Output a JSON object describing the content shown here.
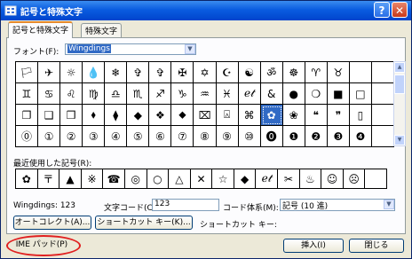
{
  "window": {
    "title": "記号と特殊文字",
    "help_glyph": "?",
    "close_glyph": "✕",
    "title_bar_color": "#0a5ce0"
  },
  "tabs": [
    {
      "label": "記号と特殊文字",
      "active": true
    },
    {
      "label": "特殊文字",
      "active": false
    }
  ],
  "font": {
    "label": "フォント(F):",
    "value": "Wingdings",
    "dropdown_glyph": "▼"
  },
  "symbol_grid": {
    "rows": [
      [
        "🏳",
        "✈",
        "☼",
        "💧",
        "❄",
        "✞",
        "✞",
        "✠",
        "✡",
        "☪",
        "☯",
        "ॐ",
        "☸",
        "♈",
        "♉"
      ],
      [
        "♊",
        "♋",
        "♌",
        "♍",
        "♎",
        "♏",
        "♐",
        "♑",
        "♒",
        "♓",
        "ℯ𝓉",
        "&",
        "●",
        "❍",
        "■",
        "□"
      ],
      [
        "❐",
        "❑",
        "❒",
        "⬧",
        "⧫",
        "◆",
        "❖",
        "⬥",
        "⌧",
        "⍓",
        "⌘",
        "✿",
        "❀",
        "❝",
        "❞",
        "▯"
      ],
      [
        "⓪",
        "①",
        "②",
        "③",
        "④",
        "⑤",
        "⑥",
        "⑦",
        "⑧",
        "⑨",
        "⑩",
        "⓿",
        "❶",
        "❷",
        "❸",
        "❹"
      ]
    ],
    "row1_full": [
      "🏳",
      "✈",
      "☼",
      "💧",
      "❄",
      "✞",
      "✞",
      "✠",
      "✡",
      "☪",
      "☯",
      "ॐ",
      "☸",
      "♈",
      "♉",
      "",
      ""
    ],
    "selected_symbol": "✿"
  },
  "recent": {
    "label": "最近使用した記号(R):",
    "symbols": [
      "✿",
      "〒",
      "▲",
      "※",
      "☎",
      "◎",
      "○",
      "△",
      "✕",
      "☆",
      "◆",
      "ℯ𝓉",
      "✂",
      "♨",
      "☺",
      "☹",
      ""
    ]
  },
  "status": {
    "char_info": "Wingdings: 123",
    "char_code_label": "文字コード(C):",
    "char_code_value": "123",
    "code_system_label": "コード体系(M):",
    "code_system_value": "記号 (10 進)",
    "shortcut_key_label": "ショートカット キー:"
  },
  "buttons": {
    "autocorrect": "オートコレクト(A)...",
    "shortcut_key": "ショートカット キー(K)...",
    "ime_pad": "IME パッド(P)",
    "insert": "挿入(I)",
    "close": "閉じる"
  },
  "scrollbar": {
    "up_glyph": "▲",
    "down_glyph": "▼"
  },
  "highlight_color": "#e02020",
  "selection_color": "#316ac5"
}
